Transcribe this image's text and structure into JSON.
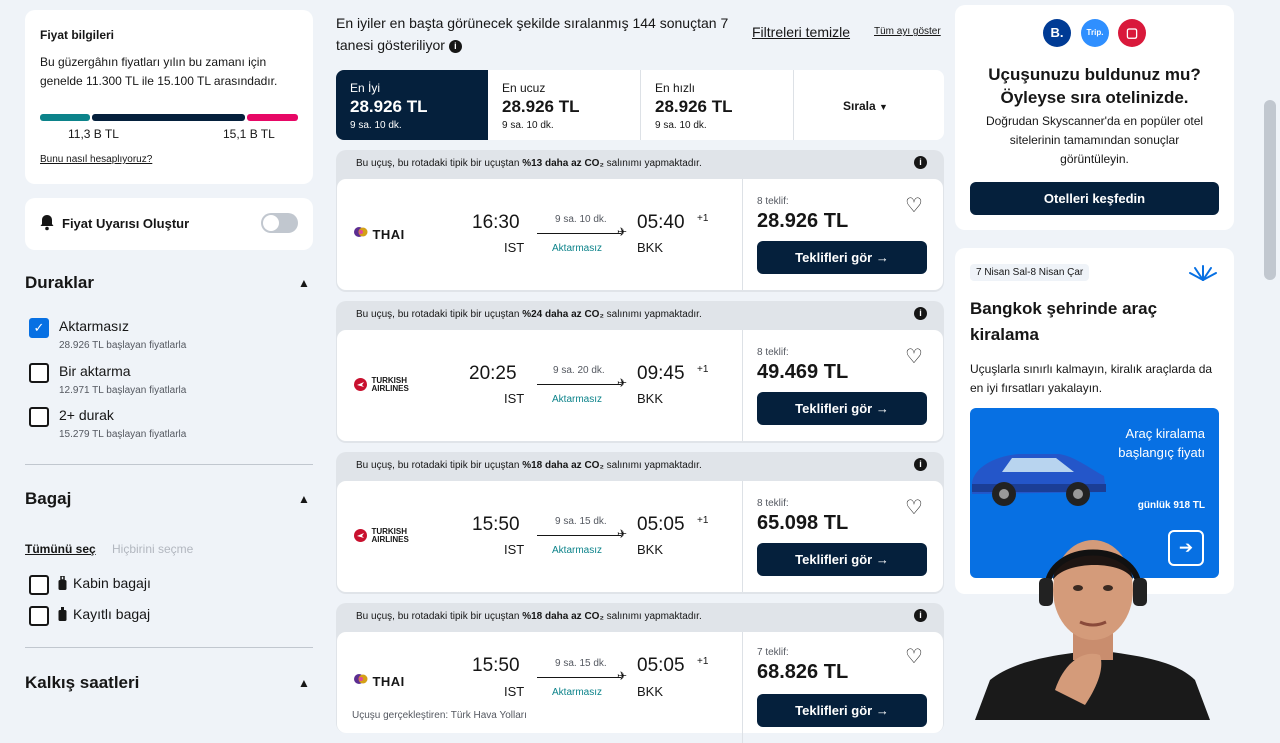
{
  "price_info": {
    "title": "Fiyat bilgileri",
    "description": "Bu güzergâhın fiyatları yılın bu zamanı için genelde 11.300 TL ile 15.100 TL arasındadır.",
    "low_label": "11,3 B TL",
    "high_label": "15,1 B TL",
    "how_link": "Bunu nasıl hesaplıyoruz?"
  },
  "alert": {
    "label": "Fiyat Uyarısı Oluştur"
  },
  "stops": {
    "heading": "Duraklar",
    "options": [
      {
        "label": "Aktarmasız",
        "sub": "28.926 TL başlayan fiyatlarla",
        "checked": true
      },
      {
        "label": "Bir aktarma",
        "sub": "12.971 TL başlayan fiyatlarla",
        "checked": false
      },
      {
        "label": "2+ durak",
        "sub": "15.279 TL başlayan fiyatlarla",
        "checked": false
      }
    ]
  },
  "baggage": {
    "heading": "Bagaj",
    "select_all": "Tümünü seç",
    "select_none": "Hiçbirini seçme",
    "options": [
      {
        "label": "Kabin bagajı"
      },
      {
        "label": "Kayıtlı bagaj"
      }
    ]
  },
  "departure": {
    "heading": "Kalkış saatleri"
  },
  "header": {
    "results_text": "En iyiler en başta görünecek şekilde sıralanmış 144 sonuçtan 7 tanesi gösteriliyor",
    "clear_filters": "Filtreleri temizle",
    "show_all": "Tüm ayı göster"
  },
  "sort_tabs": [
    {
      "label": "En İyi",
      "price": "28.926 TL",
      "duration": "9 sa. 10 dk."
    },
    {
      "label": "En ucuz",
      "price": "28.926 TL",
      "duration": "9 sa. 10 dk."
    },
    {
      "label": "En hızlı",
      "price": "28.926 TL",
      "duration": "9 sa. 10 dk."
    }
  ],
  "sort_dropdown": "Sırala",
  "flights": [
    {
      "eco_pre": "Bu uçuş, bu rotadaki tipik bir uçuştan ",
      "eco_bold": "%13 daha az CO₂",
      "eco_post": " salınımı yapmaktadır.",
      "airline": "THAI",
      "dep_time": "16:30",
      "arr_time": "05:40",
      "day_offset": "+1",
      "duration": "9 sa. 10 dk.",
      "stops": "Aktarmasız",
      "from": "IST",
      "to": "BKK",
      "offers": "8 teklif:",
      "price": "28.926 TL",
      "button": "Teklifleri gör →",
      "operated": ""
    },
    {
      "eco_pre": "Bu uçuş, bu rotadaki tipik bir uçuştan ",
      "eco_bold": "%24 daha az CO₂",
      "eco_post": " salınımı yapmaktadır.",
      "airline": "TURKISH AIRLINES",
      "dep_time": "20:25",
      "arr_time": "09:45",
      "day_offset": "+1",
      "duration": "9 sa. 20 dk.",
      "stops": "Aktarmasız",
      "from": "IST",
      "to": "BKK",
      "offers": "8 teklif:",
      "price": "49.469 TL",
      "button": "Teklifleri gör →",
      "operated": ""
    },
    {
      "eco_pre": "Bu uçuş, bu rotadaki tipik bir uçuştan ",
      "eco_bold": "%18 daha az CO₂",
      "eco_post": " salınımı yapmaktadır.",
      "airline": "TURKISH AIRLINES",
      "dep_time": "15:50",
      "arr_time": "05:05",
      "day_offset": "+1",
      "duration": "9 sa. 15 dk.",
      "stops": "Aktarmasız",
      "from": "IST",
      "to": "BKK",
      "offers": "8 teklif:",
      "price": "65.098 TL",
      "button": "Teklifleri gör →",
      "operated": ""
    },
    {
      "eco_pre": "Bu uçuş, bu rotadaki tipik bir uçuştan ",
      "eco_bold": "%18 daha az CO₂",
      "eco_post": " salınımı yapmaktadır.",
      "airline": "THAI",
      "dep_time": "15:50",
      "arr_time": "05:05",
      "day_offset": "+1",
      "duration": "9 sa. 15 dk.",
      "stops": "Aktarmasız",
      "from": "IST",
      "to": "BKK",
      "offers": "7 teklif:",
      "price": "68.826 TL",
      "button": "Teklifleri gör →",
      "operated": "Uçuşu gerçekleştiren: Türk Hava Yolları"
    }
  ],
  "hotel_ad": {
    "partners": [
      {
        "label": "B.",
        "color": "#003b95"
      },
      {
        "label": "Trip.",
        "color": "#2f8fff"
      },
      {
        "label": "▢",
        "color": "#d9193b"
      }
    ],
    "title": "Uçuşunuzu buldunuz mu? Öyleyse sıra otelinizde.",
    "description": "Doğrudan Skyscanner'da en popüler otel sitelerinin tamamından sonuçlar görüntüleyin.",
    "button": "Otelleri keşfedin"
  },
  "car_ad": {
    "dates": "7 Nisan Sal-8 Nisan Çar",
    "title": "Bangkok şehrinde araç kiralama",
    "description": "Uçuşlarla sınırlı kalmayın, kiralık araçlarda da en iyi fırsatları yakalayın.",
    "promo": "Araç kiralama başlangıç fiyatı",
    "promo_price": "günlük 918 TL"
  },
  "colors": {
    "navy": "#05203c",
    "teal": "#0c838a",
    "pink": "#e70866",
    "blue": "#0770e3"
  }
}
